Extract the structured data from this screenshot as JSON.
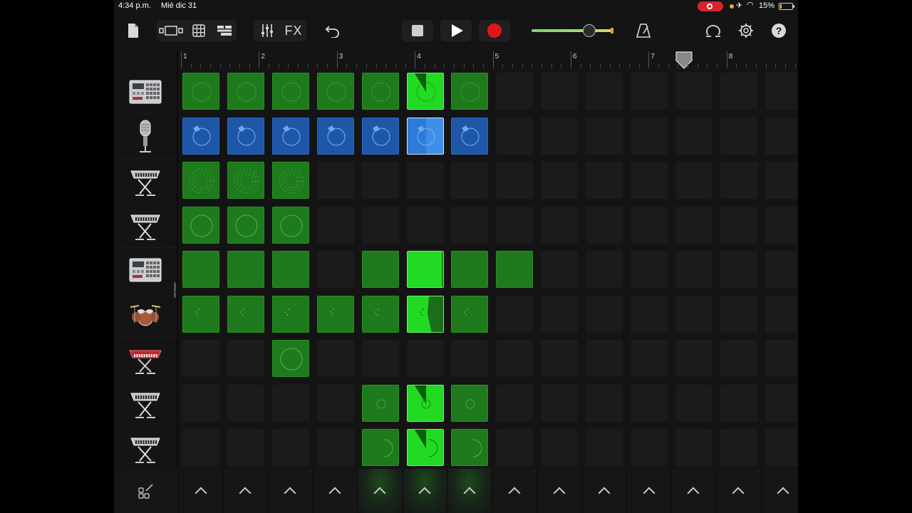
{
  "status_bar": {
    "time": "4:34 p.m.",
    "date": "Mié dic 31",
    "battery_percent": "15%",
    "battery_level": 0.15
  },
  "toolbar": {
    "fx_label": "FX",
    "volume_level": 0.72
  },
  "ruler": {
    "bars": [
      "1",
      "2",
      "3",
      "4",
      "5",
      "6",
      "7",
      "8"
    ]
  },
  "tracks": [
    {
      "name": "drum-machine",
      "icon": "drum-machine-icon"
    },
    {
      "name": "microphone",
      "icon": "microphone-icon"
    },
    {
      "name": "keyboard",
      "icon": "keyboard-stand-icon"
    },
    {
      "name": "keyboard",
      "icon": "keyboard-stand-icon"
    },
    {
      "name": "drum-machine",
      "icon": "drum-machine-icon"
    },
    {
      "name": "drum-kit",
      "icon": "drum-kit-icon"
    },
    {
      "name": "red-synth",
      "icon": "red-synth-icon"
    },
    {
      "name": "keyboard",
      "icon": "keyboard-stand-icon"
    },
    {
      "name": "keyboard",
      "icon": "keyboard-stand-icon"
    }
  ],
  "grid": {
    "columns": 14,
    "rows": [
      {
        "cells": "gggggpg......."
      },
      {
        "cells": "bbbbbqb......."
      },
      {
        "cells": "ggg..........."
      },
      {
        "cells": "ggg..........."
      },
      {
        "cells": "ggg.gpgg......"
      },
      {
        "cells": "gggggpg......."
      },
      {
        "cells": "..g..........."
      },
      {
        "cells": "....gpg......."
      },
      {
        "cells": "....gpg......."
      }
    ]
  },
  "triggers": {
    "count": 13,
    "active": [
      4,
      5,
      6
    ]
  },
  "colors": {
    "cell_green": "#1e7a1d",
    "cell_green_playing": "#22d923",
    "cell_blue": "#1f57a8",
    "record_red": "#e0151b",
    "background": "#141414"
  }
}
